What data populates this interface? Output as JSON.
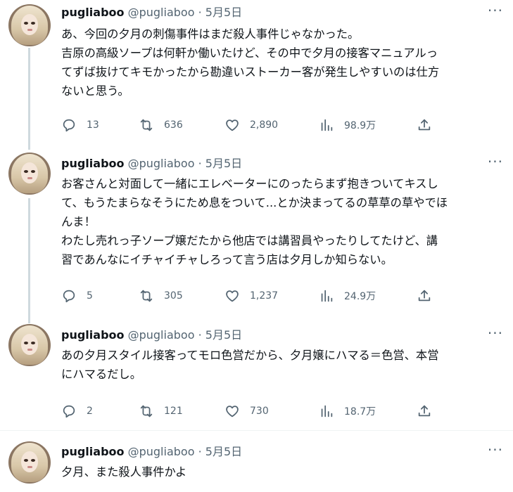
{
  "tweets": [
    {
      "name": "pugliaboo",
      "handle": "@pugliaboo",
      "dot": "·",
      "date": "5月5日",
      "lines": [
        "あ、今回の夕月の刺傷事件はまだ殺人事件じゃなかった。",
        "吉原の高級ソープは何軒か働いたけど、その中で夕月の接客マニュアルっ",
        "てずば抜けてキモかったから勘違いストーカー客が発生しやすいのは仕方",
        "ないと思う。"
      ],
      "replies": "13",
      "retweets": "636",
      "likes": "2,890",
      "views": "98.9万"
    },
    {
      "name": "pugliaboo",
      "handle": "@pugliaboo",
      "dot": "·",
      "date": "5月5日",
      "lines": [
        "お客さんと対面して一緒にエレベーターにのったらまず抱きついてキスし",
        "て、もうたまらなそうにため息をついて...とか決まってるの草草の草やでほ",
        "んま！",
        "わたし売れっ子ソープ嬢だたから他店では講習員やったりしてたけど、講",
        "習であんなにイチャイチャしろって言う店は夕月しか知らない。"
      ],
      "replies": "5",
      "retweets": "305",
      "likes": "1,237",
      "views": "24.9万"
    },
    {
      "name": "pugliaboo",
      "handle": "@pugliaboo",
      "dot": "·",
      "date": "5月5日",
      "lines": [
        "あの夕月スタイル接客ってモロ色営だから、夕月嬢にハマる＝色営、本営",
        "にハマるだし。"
      ],
      "replies": "2",
      "retweets": "121",
      "likes": "730",
      "views": "18.7万"
    },
    {
      "name": "pugliaboo",
      "handle": "@pugliaboo",
      "dot": "·",
      "date": "5月5日",
      "lines": [
        "夕月、また殺人事件かよ"
      ]
    }
  ],
  "icons": {
    "reply": "reply-icon",
    "retweet": "retweet-icon",
    "like": "heart-icon",
    "views": "views-icon",
    "share": "share-icon",
    "more": "more-icon"
  },
  "colors": {
    "text": "#0f1419",
    "muted": "#536471",
    "thread_line": "#cfd9de",
    "separator": "#eff3f4"
  }
}
